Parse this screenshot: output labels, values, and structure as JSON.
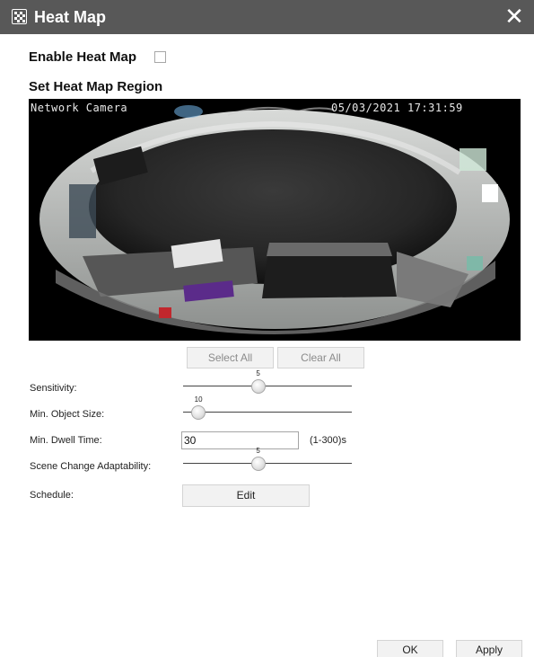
{
  "dialog": {
    "title": "Heat Map",
    "title_icon": "heat-map-grid-icon",
    "close_icon": "close-icon",
    "close_glyph": "✕"
  },
  "enable": {
    "label": "Enable Heat Map",
    "checked": false
  },
  "region": {
    "label": "Set Heat Map Region",
    "osd_name": "Network Camera",
    "osd_datetime": "05/03/2021 17:31:59",
    "select_all_label": "Select All",
    "clear_all_label": "Clear All"
  },
  "settings": {
    "sensitivity": {
      "label": "Sensitivity:",
      "value": 5,
      "min": 1,
      "max": 10
    },
    "min_object_size": {
      "label": "Min. Object Size:",
      "value": 10,
      "min": 1,
      "max": 100
    },
    "min_dwell_time": {
      "label": "Min. Dwell Time:",
      "value": "30",
      "range_note": "(1-300)s"
    },
    "scene_change": {
      "label": "Scene Change Adaptability:",
      "value": 5,
      "min": 1,
      "max": 10
    },
    "schedule": {
      "label": "Schedule:",
      "edit_label": "Edit"
    }
  },
  "footer": {
    "ok_label": "OK",
    "apply_label": "Apply"
  },
  "colors": {
    "titlebar": "#585858",
    "button_bg": "#f2f2f2",
    "button_border": "#d4d4d4"
  }
}
